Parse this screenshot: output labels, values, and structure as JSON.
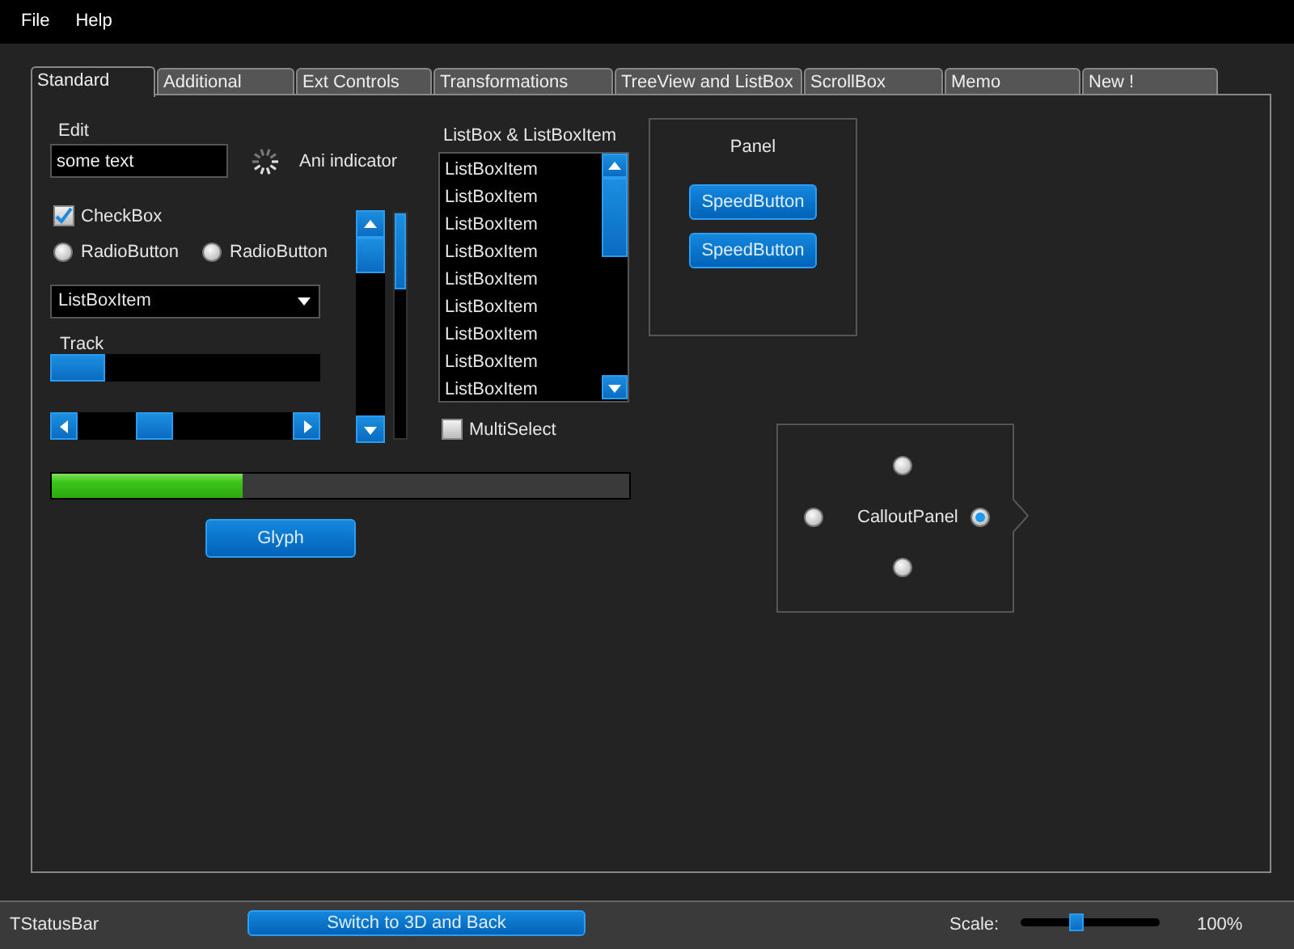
{
  "menu": [
    "File",
    "Help"
  ],
  "tabs": [
    {
      "label": "Standard",
      "selected": true
    },
    {
      "label": "Additional",
      "selected": false
    },
    {
      "label": "Ext Controls",
      "selected": false
    },
    {
      "label": "Transformations",
      "selected": false
    },
    {
      "label": "TreeView and ListBox",
      "selected": false
    },
    {
      "label": "ScrollBox",
      "selected": false
    },
    {
      "label": "Memo",
      "selected": false
    },
    {
      "label": "New !",
      "selected": false
    }
  ],
  "edit": {
    "label": "Edit",
    "value": "some text"
  },
  "ani_indicator": {
    "label": "Ani indicator"
  },
  "checkbox": {
    "label": "CheckBox",
    "checked": true
  },
  "radios": [
    {
      "label": "RadioButton",
      "selected": false
    },
    {
      "label": "RadioButton",
      "selected": false
    }
  ],
  "combo": {
    "value": "ListBoxItem"
  },
  "track": {
    "label": "Track",
    "level": 0
  },
  "listbox": {
    "title": "ListBox & ListBoxItem",
    "items": [
      "ListBoxItem",
      "ListBoxItem",
      "ListBoxItem",
      "ListBoxItem",
      "ListBoxItem",
      "ListBoxItem",
      "ListBoxItem",
      "ListBoxItem",
      "ListBoxItem"
    ]
  },
  "multiselect": {
    "label": "MultiSelect",
    "checked": false
  },
  "progress": {
    "level": 0.33
  },
  "glyph_button": "Glyph",
  "panel": {
    "title": "Panel",
    "buttons": [
      "SpeedButton",
      "SpeedButton"
    ]
  },
  "callout": {
    "label": "CalloutPanel",
    "radios": [
      {
        "selected": false
      },
      {
        "selected": false
      },
      {
        "selected": true
      },
      {
        "selected": false
      }
    ]
  },
  "status_bar": {
    "text": "TStatusBar",
    "button": "Switch to 3D and Back",
    "scale_label": "Scale:",
    "scale": {
      "level": 0.39
    },
    "scale_value": "100%"
  }
}
